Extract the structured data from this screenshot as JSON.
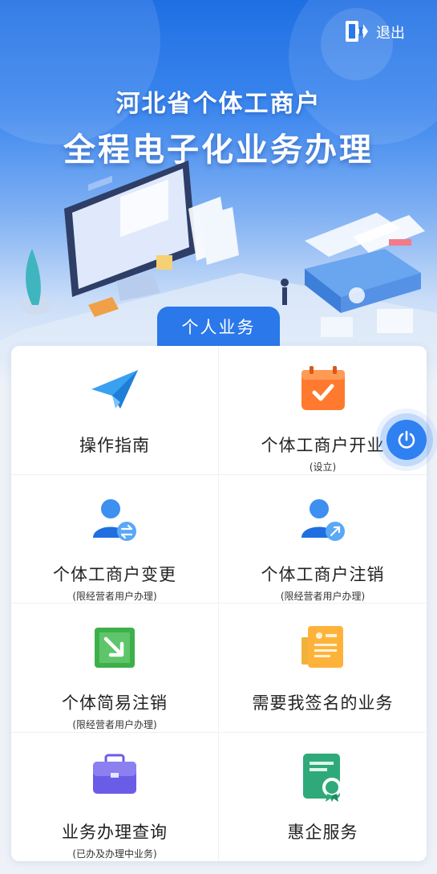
{
  "header": {
    "logout_label": "退出",
    "title_line1": "河北省个体工商户",
    "title_line2": "全程电子化业务办理"
  },
  "tab": {
    "label": "个人业务"
  },
  "services": [
    {
      "label": "操作指南",
      "sub": "",
      "icon": "paper-plane-icon"
    },
    {
      "label": "个体工商户开业",
      "sub": "(设立)",
      "icon": "calendar-check-icon"
    },
    {
      "label": "个体工商户变更",
      "sub": "(限经营者用户办理)",
      "icon": "user-swap-icon"
    },
    {
      "label": "个体工商户注销",
      "sub": "(限经营者用户办理)",
      "icon": "user-remove-icon"
    },
    {
      "label": "个体简易注销",
      "sub": "(限经营者用户办理)",
      "icon": "exit-arrow-icon"
    },
    {
      "label": "需要我签名的业务",
      "sub": "",
      "icon": "document-sign-icon"
    },
    {
      "label": "业务办理查询",
      "sub": "(已办及办理中业务)",
      "icon": "briefcase-icon"
    },
    {
      "label": "惠企服务",
      "sub": "",
      "icon": "certificate-icon"
    }
  ],
  "colors": {
    "primary": "#2a78ea",
    "banner_top": "#1f6fe4",
    "orange": "#ff7a2e",
    "green": "#3db04a",
    "purple": "#6b5ce7",
    "teal": "#2eaa7a"
  }
}
